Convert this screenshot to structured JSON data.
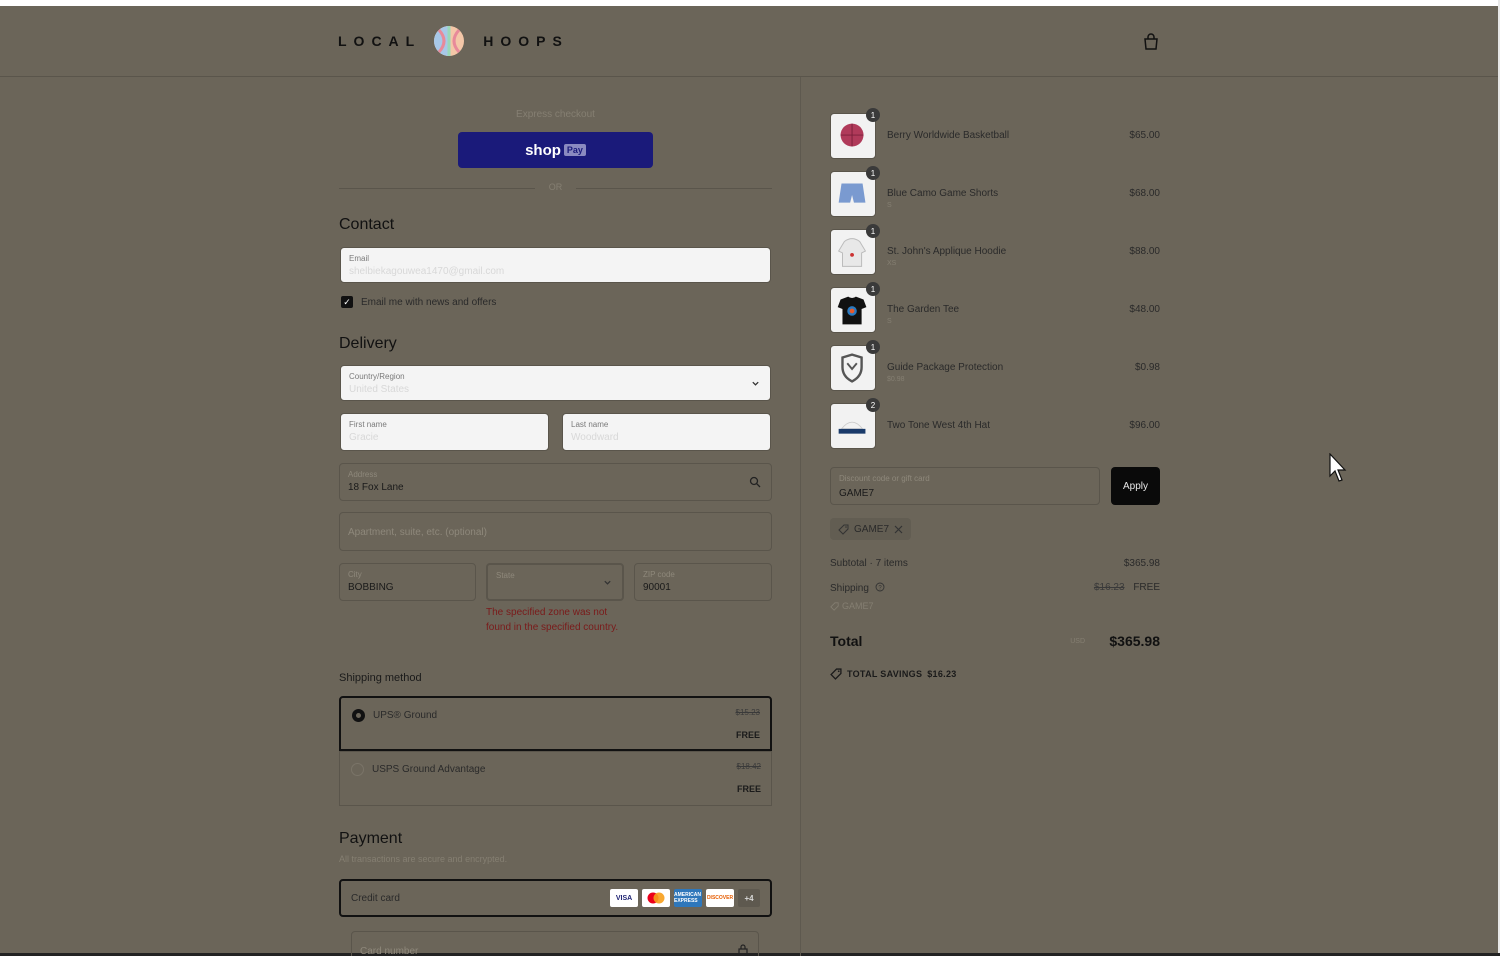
{
  "header": {
    "brand_left": "LOCAL",
    "brand_right": "HOOPS"
  },
  "express": {
    "label": "Express checkout",
    "shop_label": "shop",
    "pay_label": "Pay",
    "or_label": "OR"
  },
  "contact": {
    "heading": "Contact",
    "email_label": "Email",
    "email_value": "shelbiekagouwea1470@gmail.com",
    "newsletter_label": "Email me with news and offers",
    "newsletter_checked": "✓"
  },
  "delivery": {
    "heading": "Delivery",
    "country_label": "Country/Region",
    "country_value": "United States",
    "first_label": "First name",
    "first_value": "Gracie",
    "last_label": "Last name",
    "last_value": "Woodward",
    "address_label": "Address",
    "address_value": "18 Fox Lane",
    "apt_placeholder": "Apartment, suite, etc. (optional)",
    "city_label": "City",
    "city_value": "BOBBING",
    "state_label": "State",
    "zip_label": "ZIP code",
    "zip_value": "90001",
    "state_error": "The specified zone was not found in the specified country."
  },
  "shipping": {
    "heading": "Shipping method",
    "options": [
      {
        "name": "UPS® Ground",
        "original": "$15.23",
        "price": "FREE"
      },
      {
        "name": "USPS Ground Advantage",
        "original": "$18.42",
        "price": "FREE"
      }
    ]
  },
  "payment": {
    "heading": "Payment",
    "note": "All transactions are secure and encrypted.",
    "method": "Credit card",
    "cards": [
      "VISA",
      "",
      "AMERICAN EXPRESS",
      "DISCOVER",
      "+4"
    ],
    "card_number_placeholder": "Card number"
  },
  "cart": {
    "items": [
      {
        "name": "Berry Worldwide Basketball",
        "variant": "",
        "price": "$65.00",
        "qty": "1"
      },
      {
        "name": "Blue Camo Game Shorts",
        "variant": "S",
        "price": "$68.00",
        "qty": "1"
      },
      {
        "name": "St. John's Applique Hoodie",
        "variant": "XS",
        "price": "$88.00",
        "qty": "1"
      },
      {
        "name": "The Garden Tee",
        "variant": "S",
        "price": "$48.00",
        "qty": "1"
      },
      {
        "name": "Guide Package Protection",
        "variant": "$0.98",
        "price": "$0.98",
        "qty": "1"
      },
      {
        "name": "Two Tone West 4th Hat",
        "variant": "",
        "price": "$96.00",
        "qty": "2"
      }
    ],
    "discount_label": "Discount code or gift card",
    "discount_value": "GAME7",
    "apply_label": "Apply",
    "applied_code": "GAME7",
    "subtotal_label": "Subtotal · 7 items",
    "subtotal_value": "$365.98",
    "shipping_label": "Shipping",
    "shipping_original": "$16.23",
    "shipping_value": "FREE",
    "shipping_code": "GAME7",
    "total_label": "Total",
    "currency": "USD",
    "total_value": "$365.98",
    "savings_label": "TOTAL SAVINGS",
    "savings_value": "$16.23"
  }
}
